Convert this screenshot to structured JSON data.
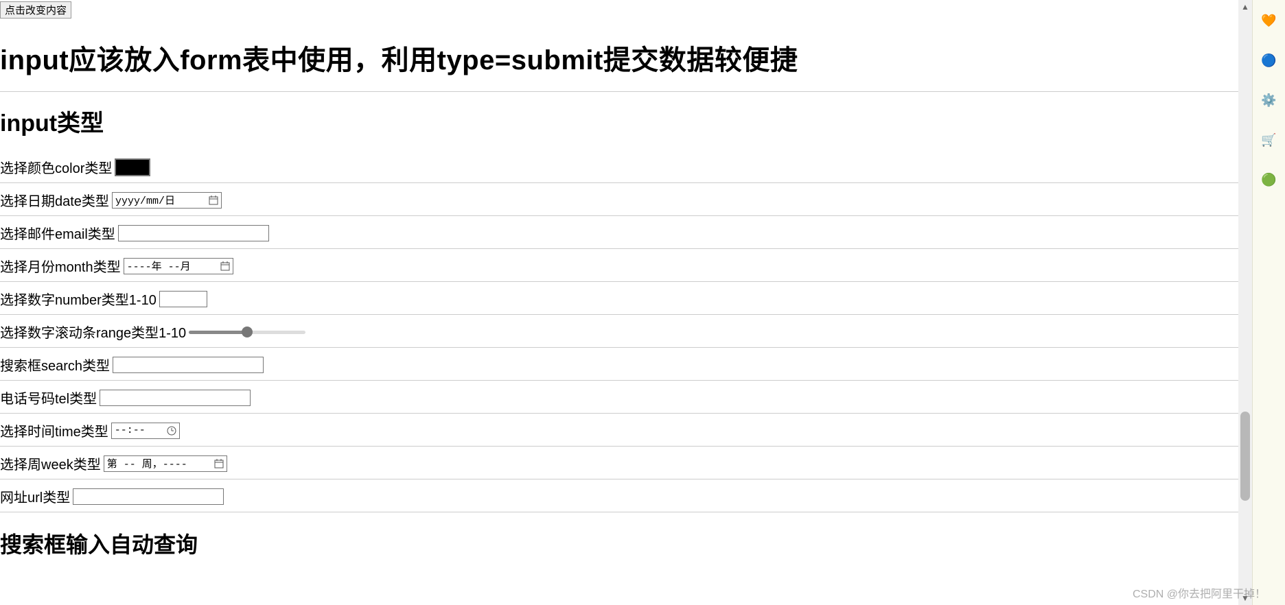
{
  "top_button_label": "点击改变内容",
  "heading_main": "input应该放入form表中使用，利用type=submit提交数据较便捷",
  "heading_types": "input类型",
  "rows": {
    "color": {
      "label": "选择颜色color类型"
    },
    "date": {
      "label": "选择日期date类型",
      "placeholder": "yyyy/mm/日"
    },
    "email": {
      "label": "选择邮件email类型"
    },
    "month": {
      "label": "选择月份month类型",
      "placeholder": "----年 --月"
    },
    "number": {
      "label": "选择数字number类型1-10"
    },
    "range": {
      "label": "选择数字滚动条range类型1-10"
    },
    "search": {
      "label": "搜索框search类型"
    },
    "tel": {
      "label": "电话号码tel类型"
    },
    "time": {
      "label": "选择时间time类型",
      "placeholder": "--:--"
    },
    "week": {
      "label": "选择周week类型",
      "placeholder": "第 -- 周，----"
    },
    "url": {
      "label": "网址url类型"
    }
  },
  "heading_datalist": "搜索框输入自动查询",
  "watermark": "CSDN @你去把阿里干掉！"
}
